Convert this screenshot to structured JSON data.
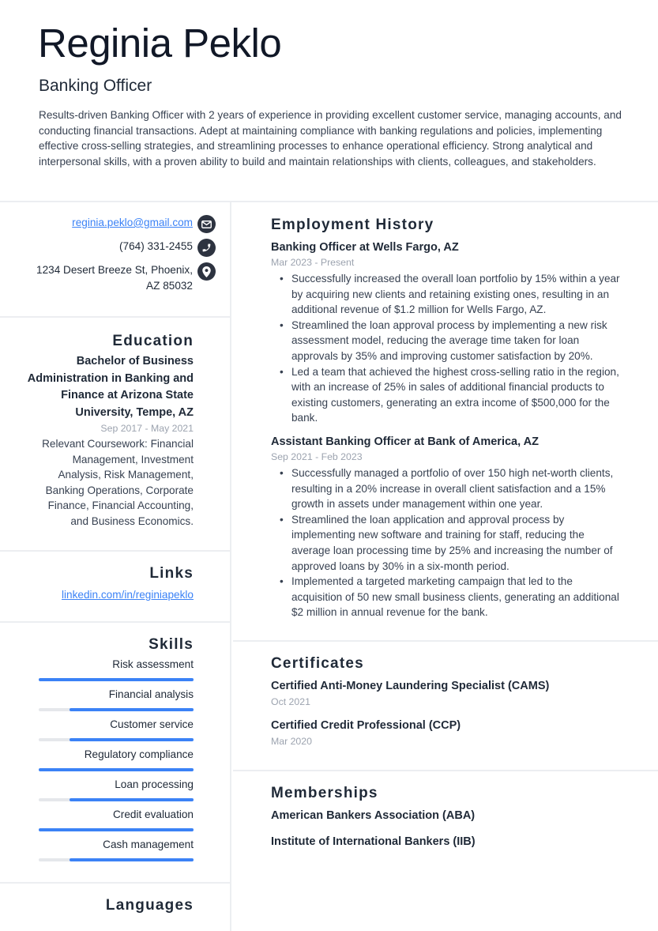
{
  "header": {
    "name": "Reginia Peklo",
    "title": "Banking Officer",
    "summary": "Results-driven Banking Officer with 2 years of experience in providing excellent customer service, managing accounts, and conducting financial transactions. Adept at maintaining compliance with banking regulations and policies, implementing effective cross-selling strategies, and streamlining processes to enhance operational efficiency. Strong analytical and interpersonal skills, with a proven ability to build and maintain relationships with clients, colleagues, and stakeholders."
  },
  "contact": {
    "email": "reginia.peklo@gmail.com",
    "phone": "(764) 331-2455",
    "address": "1234 Desert Breeze St, Phoenix, AZ 85032",
    "icons": [
      "envelope-icon",
      "phone-icon",
      "map-pin-icon"
    ]
  },
  "education": {
    "heading": "Education",
    "degree": "Bachelor of Business Administration in Banking and Finance at Arizona State University, Tempe, AZ",
    "dates": "Sep 2017 - May 2021",
    "description": "Relevant Coursework: Financial Management, Investment Analysis, Risk Management, Banking Operations, Corporate Finance, Financial Accounting, and Business Economics."
  },
  "links": {
    "heading": "Links",
    "items": [
      {
        "label": "linkedin.com/in/reginiapeklo"
      }
    ]
  },
  "skills": {
    "heading": "Skills",
    "items": [
      {
        "label": "Risk assessment",
        "level": 1.0
      },
      {
        "label": "Financial analysis",
        "level": 0.8
      },
      {
        "label": "Customer service",
        "level": 0.8
      },
      {
        "label": "Regulatory compliance",
        "level": 1.0
      },
      {
        "label": "Loan processing",
        "level": 0.8
      },
      {
        "label": "Credit evaluation",
        "level": 1.0
      },
      {
        "label": "Cash management",
        "level": 0.8
      }
    ],
    "accent": "#3b82f6",
    "track": "#e5e7eb"
  },
  "languages": {
    "heading": "Languages"
  },
  "employment": {
    "heading": "Employment History",
    "jobs": [
      {
        "title": "Banking Officer at Wells Fargo, AZ",
        "dates": "Mar 2023 - Present",
        "bullets": [
          "Successfully increased the overall loan portfolio by 15% within a year by acquiring new clients and retaining existing ones, resulting in an additional revenue of $1.2 million for Wells Fargo, AZ.",
          "Streamlined the loan approval process by implementing a new risk assessment model, reducing the average time taken for loan approvals by 35% and improving customer satisfaction by 20%.",
          "Led a team that achieved the highest cross-selling ratio in the region, with an increase of 25% in sales of additional financial products to existing customers, generating an extra income of $500,000 for the bank."
        ]
      },
      {
        "title": "Assistant Banking Officer at Bank of America, AZ",
        "dates": "Sep 2021 - Feb 2023",
        "bullets": [
          "Successfully managed a portfolio of over 150 high net-worth clients, resulting in a 20% increase in overall client satisfaction and a 15% growth in assets under management within one year.",
          "Streamlined the loan application and approval process by implementing new software and training for staff, reducing the average loan processing time by 25% and increasing the number of approved loans by 30% in a six-month period.",
          "Implemented a targeted marketing campaign that led to the acquisition of 50 new small business clients, generating an additional $2 million in annual revenue for the bank."
        ]
      }
    ]
  },
  "certificates": {
    "heading": "Certificates",
    "items": [
      {
        "title": "Certified Anti-Money Laundering Specialist (CAMS)",
        "date": "Oct 2021"
      },
      {
        "title": "Certified Credit Professional (CCP)",
        "date": "Mar 2020"
      }
    ]
  },
  "memberships": {
    "heading": "Memberships",
    "items": [
      {
        "title": "American Bankers Association (ABA)"
      },
      {
        "title": "Institute of International Bankers (IIB)"
      }
    ]
  }
}
